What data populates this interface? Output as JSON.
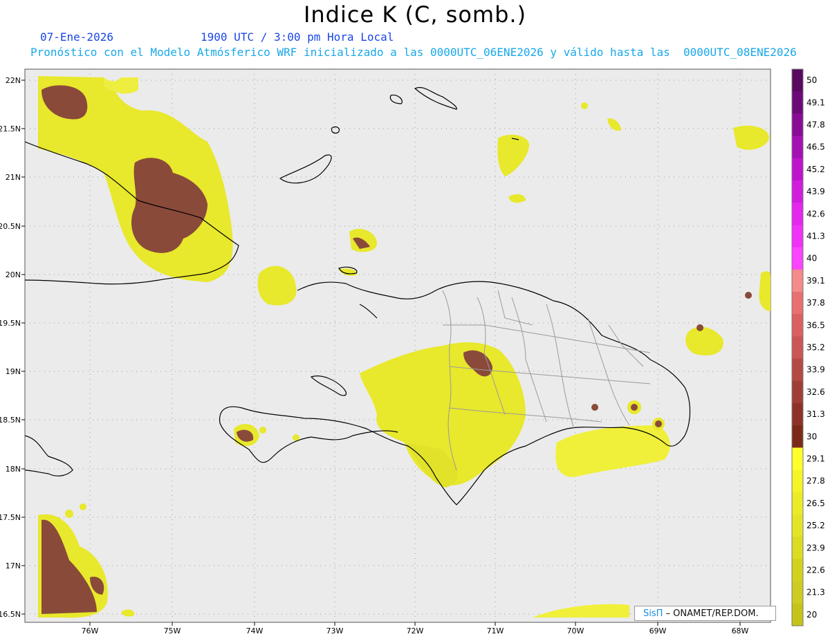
{
  "title": "Indice K (C, somb.)",
  "date": "07-Ene-2026",
  "time": "1900 UTC / 3:00 pm Hora Local",
  "description": "Pronóstico con el Modelo Atmósferico WRF inicializado a las 0000UTC_06ENE2026 y válido hasta las  0000UTC_08ENE2026",
  "credit": {
    "logo": "SisΠ",
    "text": " – ONAMET/REP.DOM."
  },
  "axes": {
    "lat_labels": [
      "22N",
      "21.5N",
      "21N",
      "20.5N",
      "20N",
      "19.5N",
      "19N",
      "18.5N",
      "18N",
      "17.5N",
      "17N",
      "16.5N"
    ],
    "lon_labels": [
      "76W",
      "75W",
      "74W",
      "73W",
      "72W",
      "71W",
      "70W",
      "69W",
      "68W"
    ]
  },
  "colorbar": {
    "labels": [
      "50",
      "49.1",
      "47.8",
      "46.5",
      "45.2",
      "43.9",
      "42.6",
      "41.3",
      "40",
      "39.1",
      "37.8",
      "36.5",
      "35.2",
      "33.9",
      "32.6",
      "31.3",
      "30",
      "29.1",
      "27.8",
      "26.5",
      "25.2",
      "23.9",
      "22.6",
      "21.3",
      "20"
    ],
    "colors": [
      "#5a0a5e",
      "#6e0a78",
      "#8a0c96",
      "#a410b4",
      "#c014cc",
      "#d21cde",
      "#e426ee",
      "#f032f8",
      "#fa44ff",
      "#f48a8a",
      "#e87070",
      "#dc6060",
      "#cc5656",
      "#b44a42",
      "#a03e36",
      "#8e3228",
      "#7c2a18",
      "#ffff2a",
      "#f4f428",
      "#ecec26",
      "#e4e426",
      "#dcdc22",
      "#d2d21e",
      "#cccc22",
      "#c4c418"
    ]
  },
  "colors": {
    "background": "#ebebeb",
    "high_k": "#8a4a3a",
    "mid_k": "#e6e62e",
    "low_k": "#f4f45a",
    "coast": "#000000",
    "province": "#9a9a9a"
  }
}
